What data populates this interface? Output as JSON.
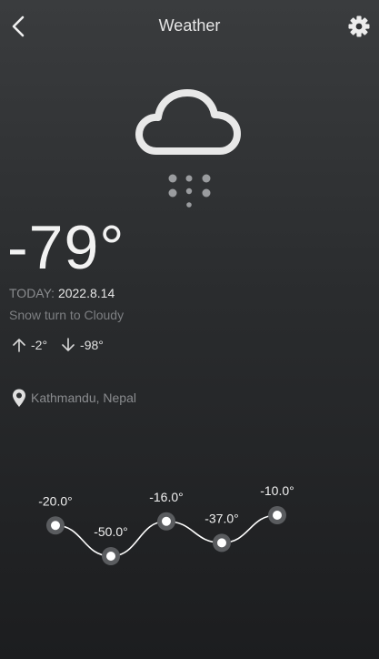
{
  "header": {
    "title": "Weather"
  },
  "icons": {
    "back": "chevron-left-icon",
    "settings": "gear-icon",
    "weather": "snow-cloud-icon",
    "up": "arrow-up-icon",
    "down": "arrow-down-icon",
    "location": "location-pin-icon"
  },
  "current": {
    "temperature": "-79°",
    "today_label": "TODAY:",
    "date": "2022.8.14",
    "description": "Snow turn to Cloudy",
    "high": "-2°",
    "low": "-98°",
    "location": "Kathmandu, Nepal"
  },
  "chart_data": {
    "type": "line",
    "labels": [
      "-20.0°",
      "-50.0°",
      "-16.0°",
      "-37.0°",
      "-10.0°"
    ],
    "values": [
      -20.0,
      -50.0,
      -16.0,
      -37.0,
      -10.0
    ],
    "ylim": [
      -50,
      -10
    ]
  }
}
